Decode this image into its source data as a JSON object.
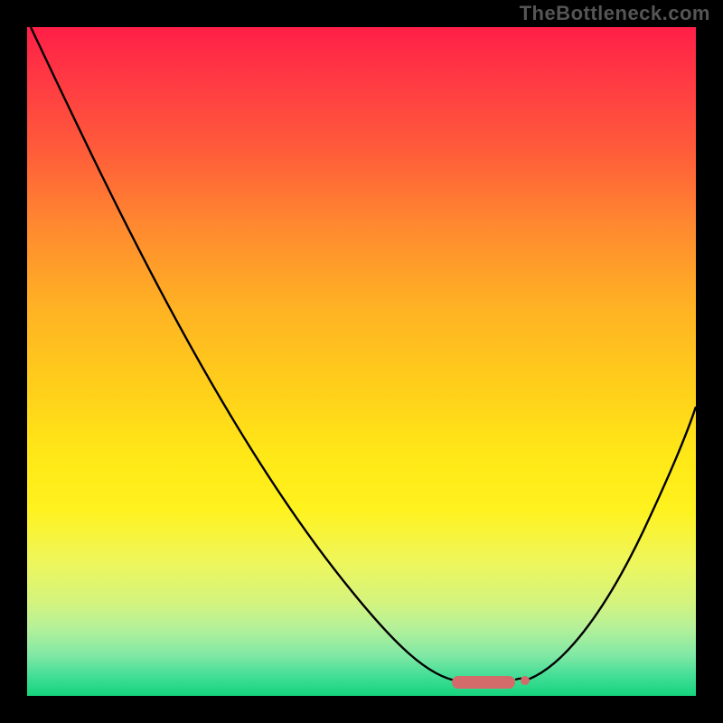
{
  "watermark": "TheBottleneck.com",
  "chart_data": {
    "type": "line",
    "title": "",
    "xlabel": "",
    "ylabel": "",
    "xlim": [
      0,
      100
    ],
    "ylim": [
      0,
      100
    ],
    "grid": false,
    "legend": false,
    "series": [
      {
        "name": "bottleneck-curve",
        "x": [
          0,
          5,
          10,
          15,
          20,
          25,
          30,
          35,
          40,
          45,
          50,
          55,
          60,
          63,
          66,
          70,
          73,
          76,
          80,
          85,
          90,
          95,
          100
        ],
        "y": [
          100,
          92,
          84,
          76,
          68,
          59,
          50,
          41,
          33,
          25,
          18,
          12,
          7,
          4,
          2,
          1,
          1,
          2,
          5,
          11,
          20,
          31,
          45
        ]
      }
    ],
    "annotations": {
      "optimal_start_x": 63,
      "optimal_end_x": 73,
      "optimal_y": 1
    },
    "colors": {
      "curve": "#000000",
      "marker": "#d46b6b",
      "gradient_top": "#ff1f47",
      "gradient_bottom": "#15d47d"
    }
  }
}
